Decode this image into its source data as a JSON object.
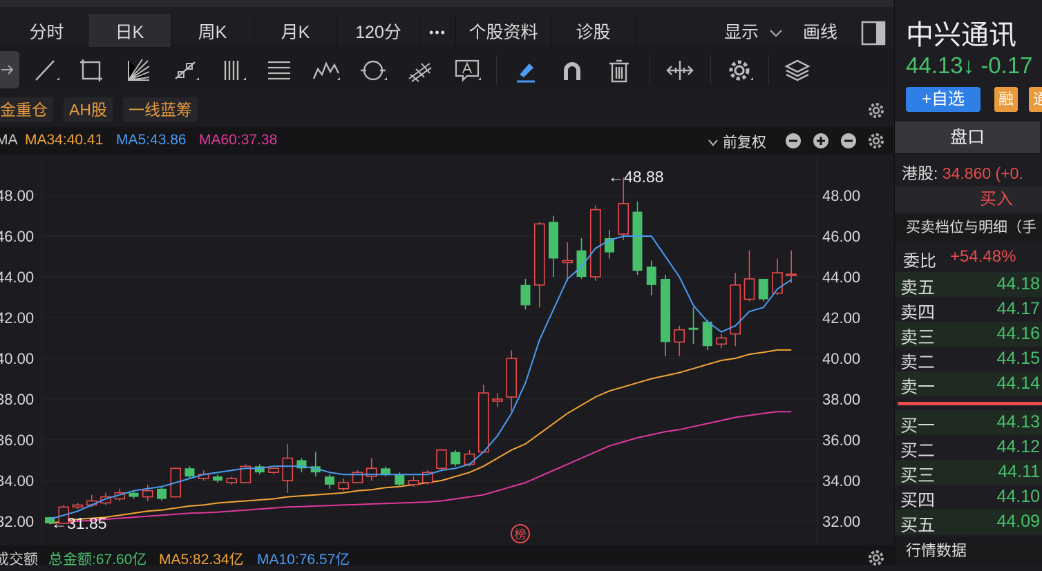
{
  "tabs": [
    "分时",
    "日K",
    "周K",
    "月K",
    "120分",
    "•••",
    "个股资料",
    "诊股"
  ],
  "toolbar_right": {
    "display_label": "显示",
    "draw_label": "画线"
  },
  "tags": [
    "金重仓",
    "AH股",
    "一线蓝筹"
  ],
  "ma_legend": {
    "prefix": "MA",
    "ma34": "MA34:40.41",
    "ma5": "MA5:43.86",
    "ma60": "MA60:37.38",
    "adjust": "前复权"
  },
  "colors": {
    "up": "#e84c4c",
    "down": "#46c06a",
    "ma5": "#4a9cf5",
    "ma34": "#f4a534",
    "ma60": "#e0389d",
    "bg": "#1c1c20"
  },
  "chart_data": {
    "type": "candlestick",
    "ylim": [
      31.2,
      49.2
    ],
    "y_ticks": [
      "48.00",
      "46.00",
      "44.00",
      "42.00",
      "40.00",
      "38.00",
      "36.00",
      "34.00",
      "32.00"
    ],
    "y_tick_values": [
      48,
      46,
      44,
      42,
      40,
      38,
      36,
      34,
      32
    ],
    "high_label": "←48.88",
    "low_label": "←31.85",
    "candles": [
      {
        "o": 32.2,
        "c": 31.9,
        "h": 32.2,
        "l": 31.85
      },
      {
        "o": 31.9,
        "c": 32.7,
        "h": 32.8,
        "l": 31.9
      },
      {
        "o": 32.7,
        "c": 32.8,
        "h": 32.9,
        "l": 32.6
      },
      {
        "o": 32.8,
        "c": 33.0,
        "h": 33.3,
        "l": 32.7
      },
      {
        "o": 32.9,
        "c": 33.2,
        "h": 33.4,
        "l": 32.8
      },
      {
        "o": 33.1,
        "c": 33.4,
        "h": 33.6,
        "l": 33.0
      },
      {
        "o": 33.4,
        "c": 33.2,
        "h": 33.5,
        "l": 33.1
      },
      {
        "o": 33.2,
        "c": 33.5,
        "h": 33.8,
        "l": 33.0
      },
      {
        "o": 33.6,
        "c": 33.1,
        "h": 33.7,
        "l": 33.0
      },
      {
        "o": 33.2,
        "c": 34.6,
        "h": 34.6,
        "l": 33.2
      },
      {
        "o": 34.6,
        "c": 34.2,
        "h": 34.7,
        "l": 34.1
      },
      {
        "o": 34.1,
        "c": 34.3,
        "h": 34.5,
        "l": 34.0
      },
      {
        "o": 34.2,
        "c": 34.0,
        "h": 34.3,
        "l": 33.9
      },
      {
        "o": 33.9,
        "c": 34.1,
        "h": 34.2,
        "l": 33.8
      },
      {
        "o": 33.9,
        "c": 34.7,
        "h": 34.8,
        "l": 33.9
      },
      {
        "o": 34.7,
        "c": 34.4,
        "h": 34.8,
        "l": 34.3
      },
      {
        "o": 34.4,
        "c": 34.6,
        "h": 34.6,
        "l": 34.3
      },
      {
        "o": 34.0,
        "c": 35.1,
        "h": 35.8,
        "l": 33.4
      },
      {
        "o": 35.0,
        "c": 34.6,
        "h": 35.1,
        "l": 34.4
      },
      {
        "o": 34.7,
        "c": 34.4,
        "h": 35.4,
        "l": 34.2
      },
      {
        "o": 34.2,
        "c": 33.8,
        "h": 34.3,
        "l": 33.6
      },
      {
        "o": 33.6,
        "c": 33.9,
        "h": 34.1,
        "l": 33.5
      },
      {
        "o": 33.9,
        "c": 34.4,
        "h": 34.5,
        "l": 33.9
      },
      {
        "o": 34.2,
        "c": 34.6,
        "h": 35.1,
        "l": 34.0
      },
      {
        "o": 34.6,
        "c": 34.3,
        "h": 34.7,
        "l": 34.2
      },
      {
        "o": 34.3,
        "c": 33.8,
        "h": 34.4,
        "l": 33.7
      },
      {
        "o": 33.8,
        "c": 34.0,
        "h": 34.2,
        "l": 33.7
      },
      {
        "o": 33.9,
        "c": 34.4,
        "h": 34.5,
        "l": 33.8
      },
      {
        "o": 34.6,
        "c": 35.5,
        "h": 35.5,
        "l": 34.5
      },
      {
        "o": 35.4,
        "c": 34.8,
        "h": 35.5,
        "l": 34.7
      },
      {
        "o": 34.8,
        "c": 35.3,
        "h": 35.5,
        "l": 34.7
      },
      {
        "o": 35.4,
        "c": 38.3,
        "h": 38.7,
        "l": 35.4
      },
      {
        "o": 37.9,
        "c": 38.0,
        "h": 38.3,
        "l": 37.6
      },
      {
        "o": 38.1,
        "c": 40.0,
        "h": 40.4,
        "l": 37.4
      },
      {
        "o": 43.6,
        "c": 42.6,
        "h": 43.9,
        "l": 42.4
      },
      {
        "o": 43.6,
        "c": 46.6,
        "h": 46.7,
        "l": 42.5
      },
      {
        "o": 46.7,
        "c": 44.9,
        "h": 47.0,
        "l": 44.0
      },
      {
        "o": 44.7,
        "c": 44.8,
        "h": 45.7,
        "l": 43.8
      },
      {
        "o": 45.3,
        "c": 44.0,
        "h": 45.9,
        "l": 43.9
      },
      {
        "o": 44.0,
        "c": 47.3,
        "h": 47.5,
        "l": 43.8
      },
      {
        "o": 45.9,
        "c": 45.2,
        "h": 46.3,
        "l": 44.9
      },
      {
        "o": 46.1,
        "c": 47.6,
        "h": 48.88,
        "l": 45.8
      },
      {
        "o": 47.2,
        "c": 44.3,
        "h": 47.7,
        "l": 44.1
      },
      {
        "o": 44.5,
        "c": 43.6,
        "h": 44.8,
        "l": 43.1
      },
      {
        "o": 43.9,
        "c": 40.8,
        "h": 44.1,
        "l": 40.1
      },
      {
        "o": 40.8,
        "c": 41.4,
        "h": 41.6,
        "l": 40.1
      },
      {
        "o": 41.5,
        "c": 41.4,
        "h": 42.5,
        "l": 40.7
      },
      {
        "o": 41.8,
        "c": 40.6,
        "h": 41.9,
        "l": 40.4
      },
      {
        "o": 40.7,
        "c": 41.0,
        "h": 41.2,
        "l": 40.5
      },
      {
        "o": 41.2,
        "c": 43.6,
        "h": 44.2,
        "l": 40.6
      },
      {
        "o": 42.9,
        "c": 43.9,
        "h": 45.3,
        "l": 42.8
      },
      {
        "o": 43.9,
        "c": 42.9,
        "h": 43.9,
        "l": 42.8
      },
      {
        "o": 43.2,
        "c": 44.2,
        "h": 44.9,
        "l": 43.1
      },
      {
        "o": 44.1,
        "c": 44.13,
        "h": 45.3,
        "l": 43.7
      }
    ],
    "ma5": [
      32.1,
      32.3,
      32.5,
      32.8,
      33.1,
      33.3,
      33.5,
      33.6,
      33.7,
      33.9,
      34.1,
      34.3,
      34.4,
      34.5,
      34.6,
      34.6,
      34.7,
      34.7,
      34.7,
      34.6,
      34.4,
      34.3,
      34.3,
      34.3,
      34.3,
      34.3,
      34.3,
      34.3,
      34.5,
      34.6,
      34.8,
      35.4,
      36.2,
      37.3,
      38.8,
      40.9,
      42.4,
      43.9,
      44.5,
      45.4,
      45.8,
      46.0,
      46.0,
      46.0,
      45.0,
      44.0,
      42.6,
      41.8,
      41.3,
      41.6,
      42.3,
      42.5,
      43.4,
      43.86
    ],
    "ma34": [
      31.9,
      32.0,
      32.1,
      32.15,
      32.2,
      32.3,
      32.4,
      32.5,
      32.55,
      32.65,
      32.75,
      32.8,
      32.9,
      32.95,
      33.0,
      33.05,
      33.1,
      33.2,
      33.25,
      33.3,
      33.35,
      33.4,
      33.5,
      33.55,
      33.65,
      33.7,
      33.8,
      33.9,
      34.0,
      34.2,
      34.4,
      34.7,
      35.1,
      35.5,
      35.8,
      36.3,
      36.8,
      37.3,
      37.7,
      38.1,
      38.4,
      38.6,
      38.8,
      39.0,
      39.15,
      39.3,
      39.5,
      39.7,
      39.9,
      40.0,
      40.2,
      40.3,
      40.41,
      40.41
    ],
    "ma60": [
      31.9,
      31.95,
      32.0,
      32.05,
      32.1,
      32.15,
      32.2,
      32.25,
      32.3,
      32.35,
      32.4,
      32.42,
      32.45,
      32.5,
      32.55,
      32.6,
      32.65,
      32.7,
      32.72,
      32.75,
      32.77,
      32.8,
      32.82,
      32.85,
      32.87,
      32.9,
      32.92,
      32.95,
      33.0,
      33.1,
      33.2,
      33.3,
      33.5,
      33.7,
      33.9,
      34.2,
      34.5,
      34.8,
      35.1,
      35.4,
      35.7,
      35.9,
      36.1,
      36.25,
      36.4,
      36.5,
      36.65,
      36.8,
      36.95,
      37.1,
      37.2,
      37.3,
      37.38,
      37.38
    ],
    "badge": "榜"
  },
  "volume_legend": {
    "title": "成交额",
    "total": "总金额:67.60亿",
    "ma5": "MA5:82.34亿",
    "ma10": "MA10:76.57亿"
  },
  "stock": {
    "name": "中兴通讯",
    "price": "44.13",
    "arrow": "↓",
    "change": "-0.17",
    "add_watch": "+自选",
    "badge_rong": "融",
    "badge_tong": "通",
    "pankou": "盘口",
    "hk_label": "港股:",
    "hk_value": "34.860 (+0.",
    "buy_label": "买入",
    "depth_title": "买卖档位与明细（手",
    "weibi_label": "委比",
    "weibi_value": "+54.48%",
    "asks": [
      {
        "label": "卖五",
        "price": "44.18"
      },
      {
        "label": "卖四",
        "price": "44.17"
      },
      {
        "label": "卖三",
        "price": "44.16"
      },
      {
        "label": "卖二",
        "price": "44.15"
      },
      {
        "label": "卖一",
        "price": "44.14"
      }
    ],
    "bids": [
      {
        "label": "买一",
        "price": "44.13"
      },
      {
        "label": "买二",
        "price": "44.12"
      },
      {
        "label": "买三",
        "price": "44.11"
      },
      {
        "label": "买四",
        "price": "44.10"
      },
      {
        "label": "买五",
        "price": "44.09"
      }
    ],
    "market_data": "行情数据"
  }
}
